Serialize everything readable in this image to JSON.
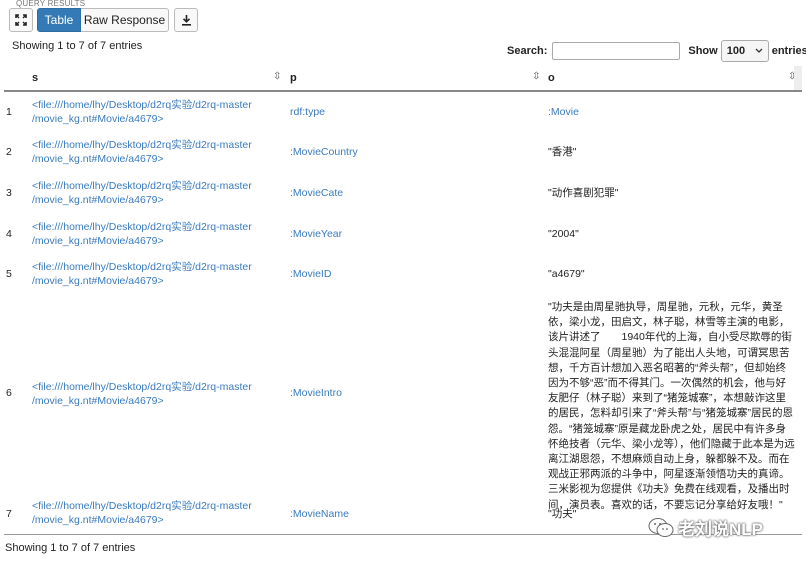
{
  "panel": {
    "label": "QUERY RESULTS"
  },
  "toolbar": {
    "table_label": "Table",
    "raw_label": "Raw Response"
  },
  "info": {
    "top": "Showing 1 to 7 of 7 entries",
    "bottom": "Showing 1 to 7 of 7 entries"
  },
  "search": {
    "label": "Search:",
    "value": "",
    "placeholder": ""
  },
  "length": {
    "show_label": "Show",
    "value": "100",
    "entries_label": "entries"
  },
  "columns": [
    "s",
    "p",
    "o"
  ],
  "rows": [
    {
      "num": "1",
      "s1": "<file:///home/lhy/Desktop/d2rq实验/d2rq-master",
      "s2": "/movie_kg.nt#Movie/a4679>",
      "p": "rdf:type",
      "o": ":Movie"
    },
    {
      "num": "2",
      "s1": "<file:///home/lhy/Desktop/d2rq实验/d2rq-master",
      "s2": "/movie_kg.nt#Movie/a4679>",
      "p": ":MovieCountry",
      "o": "\"香港\""
    },
    {
      "num": "3",
      "s1": "<file:///home/lhy/Desktop/d2rq实验/d2rq-master",
      "s2": "/movie_kg.nt#Movie/a4679>",
      "p": ":MovieCate",
      "o": "\"动作喜剧犯罪\""
    },
    {
      "num": "4",
      "s1": "<file:///home/lhy/Desktop/d2rq实验/d2rq-master",
      "s2": "/movie_kg.nt#Movie/a4679>",
      "p": ":MovieYear",
      "o": "\"2004\""
    },
    {
      "num": "5",
      "s1": "<file:///home/lhy/Desktop/d2rq实验/d2rq-master",
      "s2": "/movie_kg.nt#Movie/a4679>",
      "p": ":MovieID",
      "o": "\"a4679\""
    },
    {
      "num": "6",
      "s1": "<file:///home/lhy/Desktop/d2rq实验/d2rq-master",
      "s2": "/movie_kg.nt#Movie/a4679>",
      "p": ":MovieIntro",
      "o": "\"功夫是由周星驰执导，周星驰，元秋，元华，黄圣依，梁小龙，田启文，林子聪，林雪等主演的电影，该片讲述了　　1940年代的上海，自小受尽欺辱的街头混混阿星（周星驰）为了能出人头地，可谓冥思苦想，千方百计想加入恶名昭著的“斧头帮”，但却始终因为不够“恶”而不得其门。一次偶然的机会，他与好友肥仔（林子聪）来到了“猪笼城寨”，本想敲诈这里的居民，怎料却引来了“斧头帮”与“猪笼城寨”居民的恩怨。“猪笼城寨”原是藏龙卧虎之处，居民中有许多身怀绝技者（元华、梁小龙等），他们隐藏于此本是为远离江湖恩怨，不想麻烦自动上身，躲都躲不及。而在观战正邪两派的斗争中，阿星逐渐领悟功夫的真谛。三米影视为您提供《功夫》免费在线观看，及播出时间，演员表。喜欢的话，不要忘记分享给好友哦！\""
    },
    {
      "num": "7",
      "s1": "<file:///home/lhy/Desktop/d2rq实验/d2rq-master",
      "s2": "/movie_kg.nt#Movie/a4679>",
      "p": ":MovieName",
      "o": "\"功夫\""
    }
  ],
  "watermark": {
    "text": "老刘说NLP"
  }
}
